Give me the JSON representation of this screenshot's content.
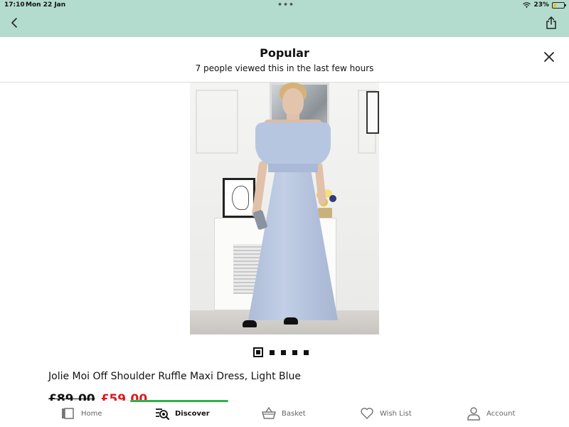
{
  "status_bar": {
    "time": "17:10",
    "date": "Mon 22 Jan",
    "battery": "23%",
    "battery_level": 0.23
  },
  "header": {
    "back_icon": "chevron-left-icon",
    "share_icon": "share-icon"
  },
  "popular": {
    "title": "Popular",
    "subtitle": "7 people viewed this in the last few hours",
    "close_icon": "close-icon"
  },
  "carousel": {
    "total": 5,
    "active": 1
  },
  "product": {
    "name": "Jolie Moi Off Shoulder Ruffle Maxi Dress, Light Blue",
    "old_price": "£89.00",
    "new_price": "£59.00",
    "sale_color": "#e0161d"
  },
  "bottom_nav": {
    "items": [
      {
        "label": "Home",
        "icon": "home-icon"
      },
      {
        "label": "Discover",
        "icon": "discover-icon",
        "active": true
      },
      {
        "label": "Basket",
        "icon": "basket-icon"
      },
      {
        "label": "Wish List",
        "icon": "heart-icon"
      },
      {
        "label": "Account",
        "icon": "account-icon"
      }
    ],
    "active_color": "#2db34a"
  },
  "theme": {
    "topbar_color": "#b3dccf"
  }
}
